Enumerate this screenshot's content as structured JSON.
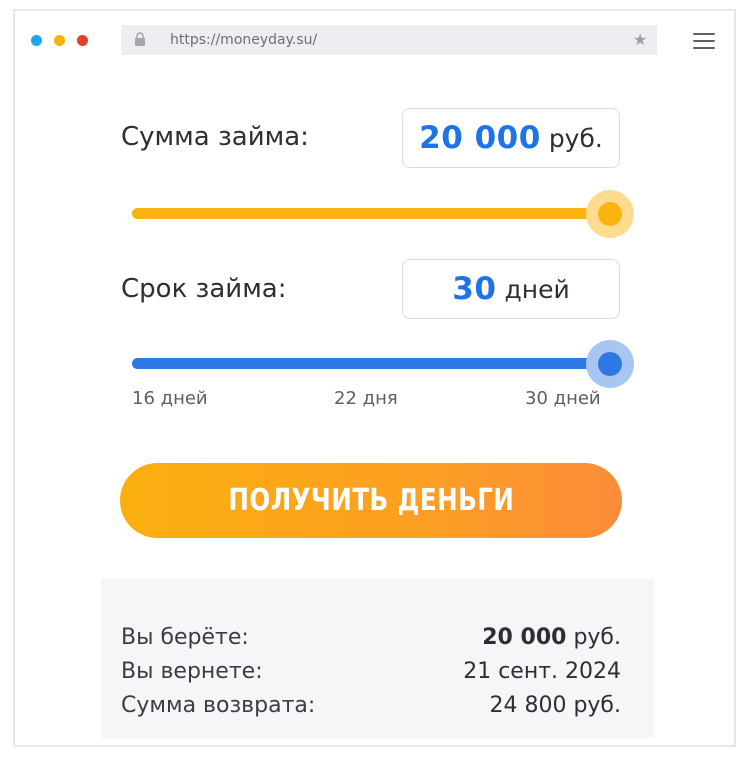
{
  "browser": {
    "url": "https://moneyday.su/",
    "dot_colors": [
      "#1aa7ec",
      "#f5b400",
      "#e0412b"
    ]
  },
  "amount": {
    "label": "Сумма займа:",
    "value": "20 000",
    "unit": "руб.",
    "slider_fraction": 1.0
  },
  "term": {
    "label": "Срок займа:",
    "value": "30",
    "unit": "дней",
    "slider_fraction": 1.0,
    "ticks": [
      "16 дней",
      "22 дня",
      "30 дней"
    ]
  },
  "cta": {
    "label": "ПОЛУЧИТЬ ДЕНЬГИ"
  },
  "summary": {
    "rows": [
      {
        "label": "Вы берёте:",
        "value_bold": "20 000",
        "value_rest": " руб."
      },
      {
        "label": "Вы вернете:",
        "value_bold": "",
        "value_rest": "21 сент. 2024"
      },
      {
        "label": "Сумма возврата:",
        "value_bold": "",
        "value_rest": "24 800 руб."
      }
    ]
  },
  "colors": {
    "amount_slider": "#fbb40f",
    "term_slider": "#2c79e4",
    "accent_value": "#1d73e8"
  }
}
